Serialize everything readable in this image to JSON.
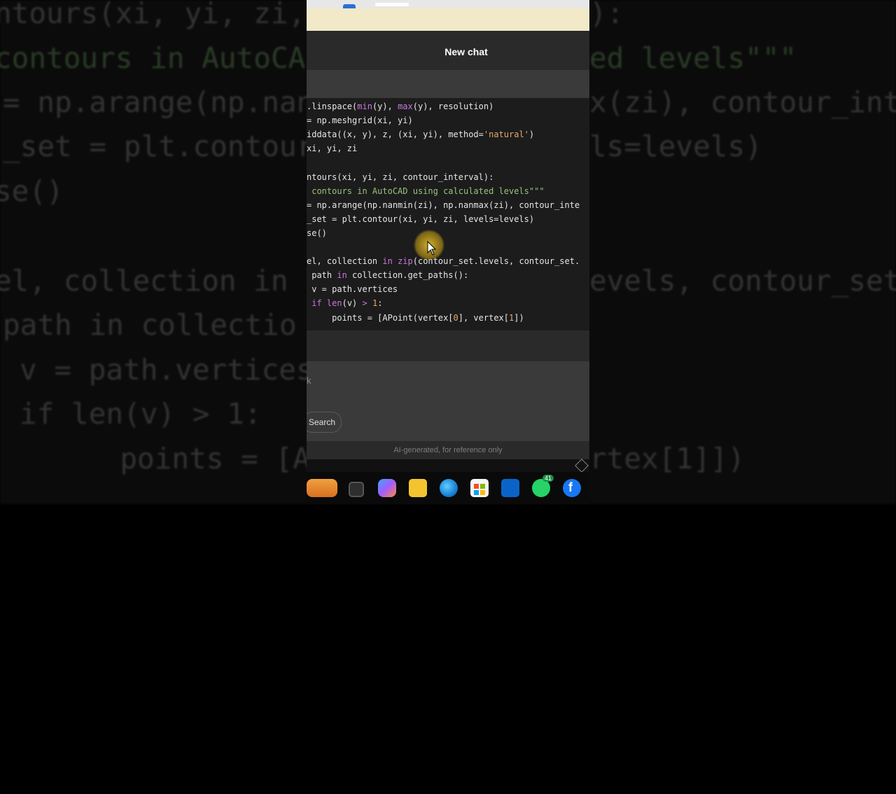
{
  "background_code": {
    "left_lines": [
      "ntours(xi, yi, zi,",
      "contours in AutoCA",
      "= np.arange(np.nan",
      "_set = plt.contour",
      "se()",
      "",
      "el, collection in z",
      "path in collectio",
      "v = path.vertices",
      "if len(v) > 1:",
      "  points = [APo"
    ],
    "right_lines": [
      "):",
      "ed levels\"\"\"",
      "x(zi), contour_inte",
      "ls=levels)",
      "",
      "",
      "evels, contour_set.",
      "",
      "",
      "",
      "rtex[1]])"
    ]
  },
  "header": {
    "title": "New chat"
  },
  "code": {
    "lines": [
      ".linspace(min(y), max(y), resolution)",
      "= np.meshgrid(xi, yi)",
      "iddata((x, y), z, (xi, yi), method='natural')",
      "xi, yi, zi",
      "",
      "ntours(xi, yi, zi, contour_interval):",
      " contours in AutoCAD using calculated levels\"\"\"",
      "= np.arange(np.nanmin(zi), np.nanmax(zi), contour_inte",
      "_set = plt.contour(xi, yi, zi, levels=levels)",
      "se()",
      "",
      "el, collection in zip(contour_set.levels, contour_set.",
      " path in collection.get_paths():",
      " v = path.vertices",
      " if len(v) > 1:",
      "     points = [APoint(vertex[0], vertex[1])"
    ]
  },
  "input": {
    "cursor_text": "k"
  },
  "buttons": {
    "search": "Search"
  },
  "footer": {
    "disclaimer": "AI-generated, for reference only"
  },
  "taskbar": {
    "icons": [
      "weather-icon",
      "task-view-icon",
      "copilot-icon",
      "file-explorer-icon",
      "edge-icon",
      "microsoft-store-icon",
      "outlook-icon",
      "whatsapp-icon",
      "facebook-icon"
    ],
    "whatsapp_badge": "41"
  },
  "colors": {
    "keyword": "#c678dd",
    "comment": "#98c379",
    "string": "#e5a96b",
    "code_bg": "#1c1c1c"
  }
}
